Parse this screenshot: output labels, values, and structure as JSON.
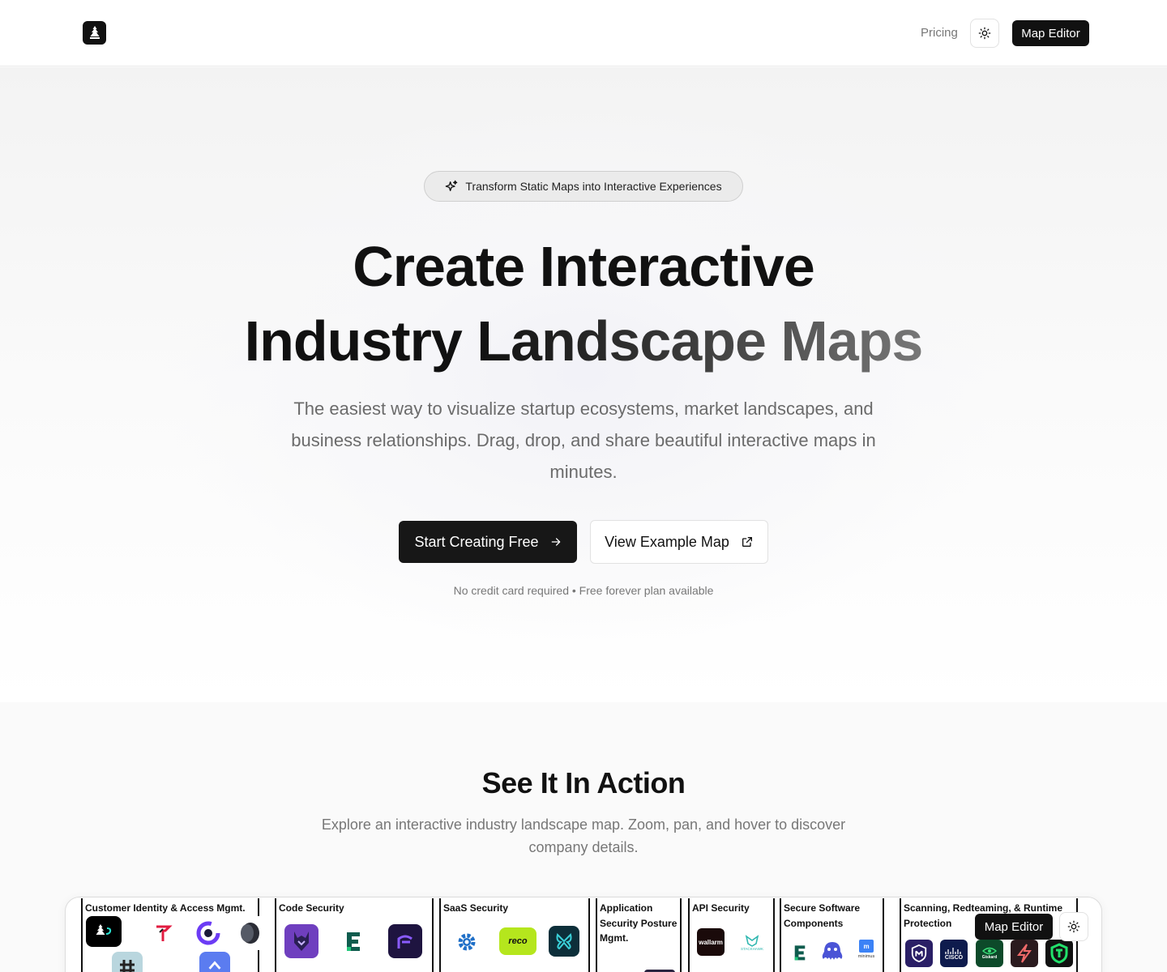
{
  "header": {
    "logo_icon": "tree-logo-icon",
    "pricing_label": "Pricing",
    "theme_icon": "sun-icon",
    "map_editor_label": "Map Editor"
  },
  "hero": {
    "pill_icon": "sparkles-icon",
    "pill_text": "Transform Static Maps into Interactive Experiences",
    "title_line1": "Create Interactive",
    "title_line2_word1": "Industry",
    "title_line2_grad": "Landscape Maps",
    "subtitle": "The easiest way to visualize startup ecosystems, market landscapes, and business relationships. Drag, drop, and share beautiful interactive maps in minutes.",
    "cta_primary_label": "Start Creating Free",
    "cta_primary_icon": "arrow-right-icon",
    "cta_secondary_label": "View Example Map",
    "cta_secondary_icon": "external-link-icon",
    "note": "No credit card required • Free forever plan available"
  },
  "demo": {
    "title": "See It In Action",
    "subtitle": "Explore an interactive industry landscape map. Zoom, pan, and hover to discover company details.",
    "map": {
      "categories": [
        {
          "title": "Customer Identity & Access Mgmt."
        },
        {
          "title": "Code Security"
        },
        {
          "title": "SaaS Security"
        },
        {
          "title": "Application Security Posture Mgmt."
        },
        {
          "title": "API Security"
        },
        {
          "title": "Secure Software Components"
        },
        {
          "title": "Scanning, Redteaming, & Runtime Protection"
        }
      ],
      "logo_texts": {
        "reco": "reco",
        "wallarm": "wallarm",
        "stackhawk": "STACKHAWK",
        "minimus": "minimus",
        "cisco": "CISCO",
        "giskard": "Giskard"
      },
      "overlay_editor_label": "Map Editor",
      "overlay_theme_icon": "sun-icon"
    }
  },
  "colors": {
    "primary": "#111111",
    "muted_text": "#6b6b6b",
    "border": "#e2e2e2"
  }
}
